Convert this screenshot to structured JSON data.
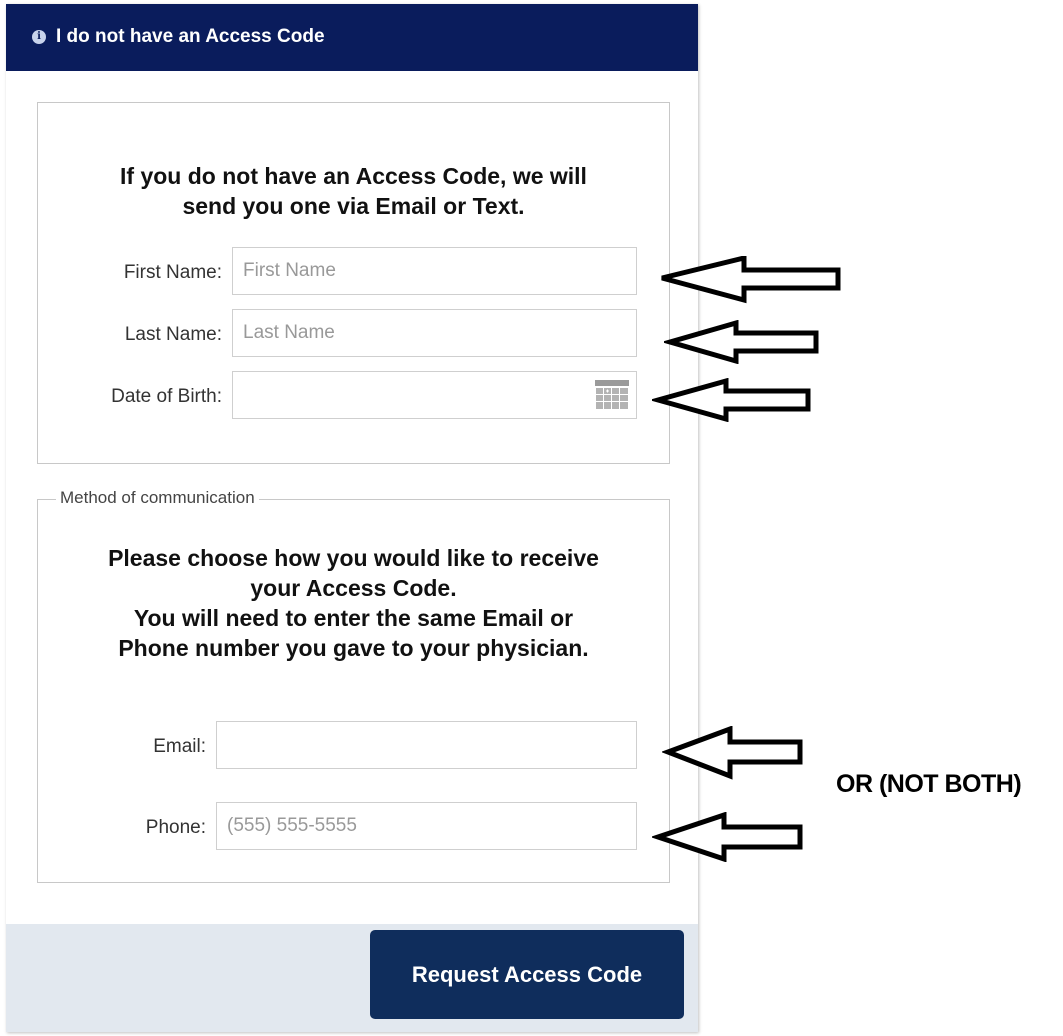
{
  "header": {
    "title": "I do not have an Access Code",
    "icon": "info-icon"
  },
  "identity_section": {
    "heading_line1": "If you do not have an Access Code, we will",
    "heading_line2": "send you one via Email or Text.",
    "first_name": {
      "label": "First Name:",
      "placeholder": "First Name",
      "value": ""
    },
    "last_name": {
      "label": "Last Name:",
      "placeholder": "Last Name",
      "value": ""
    },
    "dob": {
      "label": "Date of Birth:",
      "value": "",
      "icon": "calendar-icon"
    }
  },
  "communication_section": {
    "legend": "Method of communication",
    "heading_lines": [
      "Please choose how you would like to receive",
      "your Access Code.",
      "You will need to enter the same Email or",
      "Phone number you gave to your physician."
    ],
    "email": {
      "label": "Email:",
      "value": ""
    },
    "phone": {
      "label": "Phone:",
      "placeholder": "(555) 555-5555",
      "value": ""
    }
  },
  "footer": {
    "button_label": "Request Access Code"
  },
  "annotations": {
    "note": "OR (NOT BOTH)",
    "arrow_color": "#000000"
  },
  "colors": {
    "header_bg": "#0a1c5c",
    "button_bg": "#0f2d5c",
    "footer_bg": "#e2e8ef"
  }
}
